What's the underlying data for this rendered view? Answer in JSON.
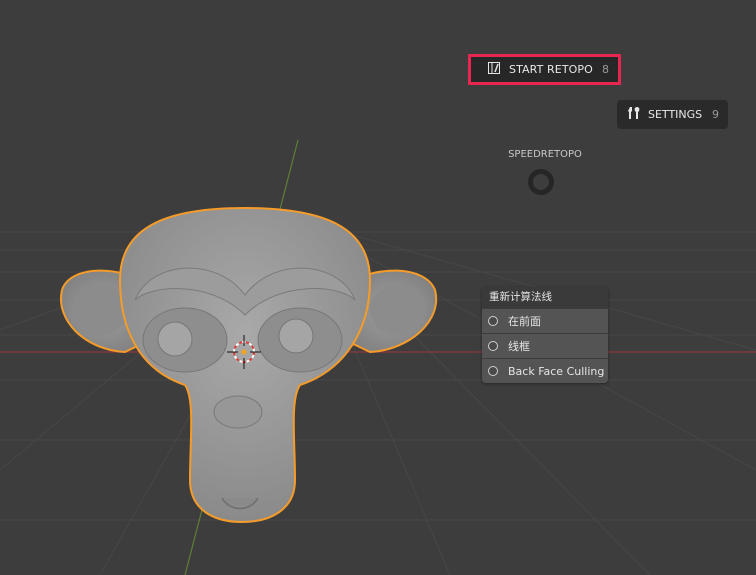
{
  "pie_menu": {
    "title": "SPEEDRETOPO",
    "start_retopo": {
      "label": "START RETOPO",
      "shortcut": "8"
    },
    "settings": {
      "label": "SETTINGS",
      "shortcut": "9"
    }
  },
  "overlay_panel": {
    "title": "重新计算法线",
    "options": [
      {
        "label": "在前面"
      },
      {
        "label": "线框"
      },
      {
        "label": "Back Face Culling"
      }
    ]
  },
  "colors": {
    "background": "#3d3d3d",
    "highlight_border": "#e8264f",
    "selection_outline": "#f59b2a",
    "x_axis": "#a83a48",
    "y_axis": "#6b8f3a"
  },
  "icons": {
    "start_retopo": "retopo-icon",
    "settings": "wrench-screwdriver-icon",
    "cursor": "3d-cursor-icon",
    "pie_center": "pie-ring-icon"
  }
}
